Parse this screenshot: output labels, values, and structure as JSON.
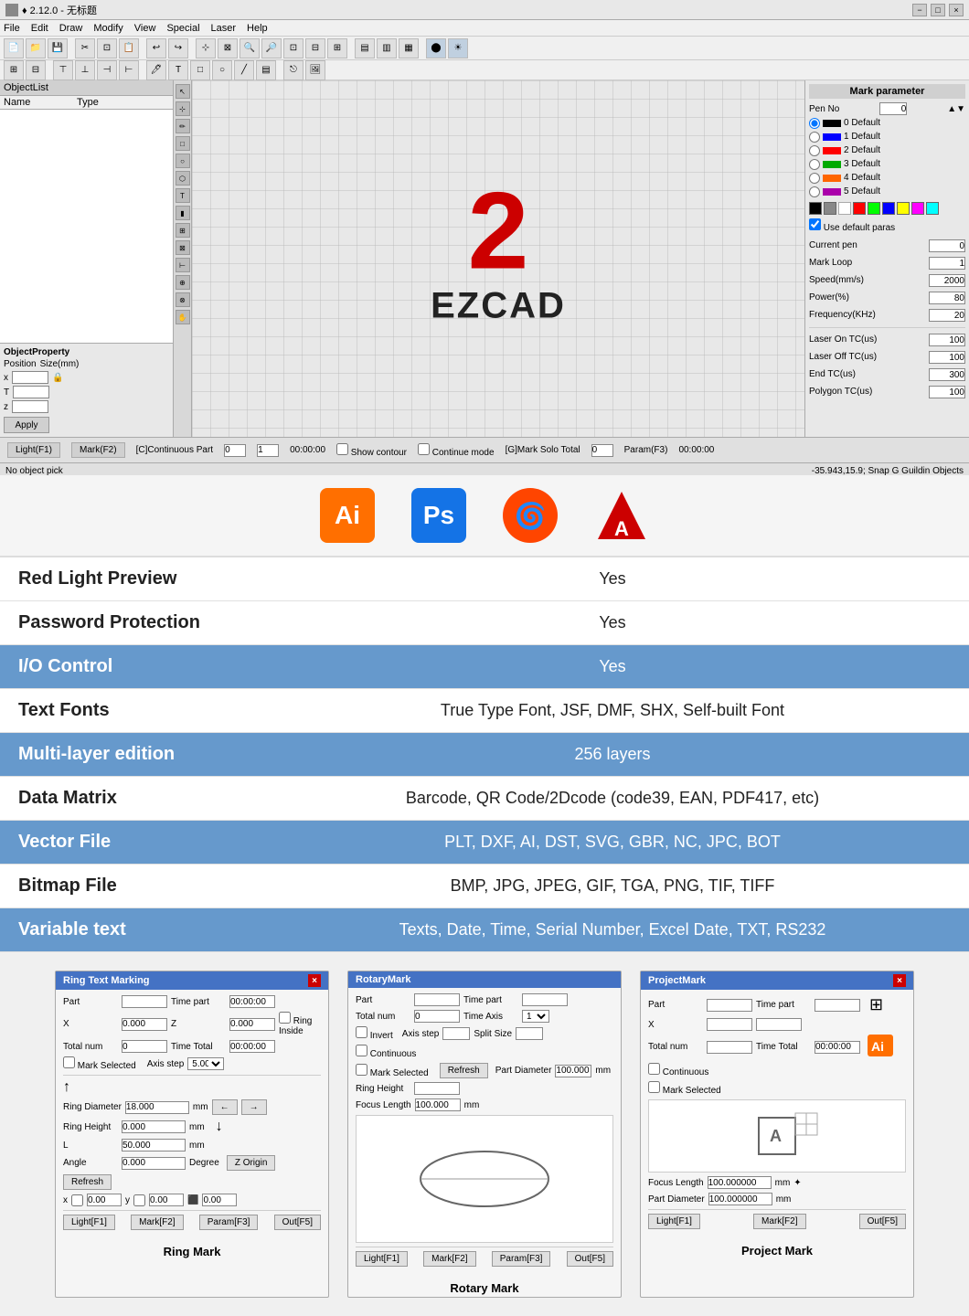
{
  "window": {
    "title": "2.12.0 - 无标题",
    "titlebar": "♦ 2.12.0 - 无标题",
    "controls": [
      "−",
      "□",
      "×"
    ]
  },
  "menubar": {
    "items": [
      "File",
      "Edit",
      "Draw",
      "Modify",
      "View",
      "Special",
      "Laser",
      "Help"
    ]
  },
  "canvas": {
    "number": "2",
    "text": "EZCAD"
  },
  "right_panel": {
    "title": "Mark parameter",
    "pen_no_label": "Pen No",
    "pens": [
      {
        "label": "Default",
        "color": "#000000"
      },
      {
        "label": "1 Default",
        "color": "#0000ff"
      },
      {
        "label": "2 Default",
        "color": "#ff0000"
      },
      {
        "label": "3 Default",
        "color": "#00aa00"
      },
      {
        "label": "4 Default",
        "color": "#ff6600"
      },
      {
        "label": "5 Default",
        "color": "#aa00aa"
      }
    ],
    "params": [
      {
        "label": "Use default paras",
        "type": "checkbox"
      },
      {
        "label": "Current pen",
        "value": "0"
      },
      {
        "label": "Mark Loop",
        "value": "1"
      },
      {
        "label": "Speed(mm/s)",
        "value": "2000"
      },
      {
        "label": "Power(%)",
        "value": "80"
      },
      {
        "label": "Frequency(KHz)",
        "value": "20"
      },
      {
        "label": "Laser On TC(us)",
        "value": "100"
      },
      {
        "label": "Laser Off TC(us)",
        "value": "100"
      },
      {
        "label": "End TC(us)",
        "value": "300"
      },
      {
        "label": "Polygon TC(us)",
        "value": "100"
      }
    ]
  },
  "icons": [
    {
      "id": "ai",
      "label": "Ai",
      "class": "icon-ai"
    },
    {
      "id": "ps",
      "label": "Ps",
      "class": "icon-ps"
    },
    {
      "id": "sn",
      "label": "🌀",
      "class": "icon-sn"
    },
    {
      "id": "a",
      "label": "A",
      "class": "icon-a"
    }
  ],
  "features": [
    {
      "label": "Red Light Preview",
      "value": "Yes",
      "highlight": false
    },
    {
      "label": "Password Protection",
      "value": "Yes",
      "highlight": false
    },
    {
      "label": "I/O Control",
      "value": "Yes",
      "highlight": true
    },
    {
      "label": "Text Fonts",
      "value": "True Type Font, JSF, DMF, SHX, Self-built Font",
      "highlight": false
    },
    {
      "label": "Multi-layer edition",
      "value": "256 layers",
      "highlight": true
    },
    {
      "label": "Data Matrix",
      "value": "Barcode, QR Code/2Dcode (code39, EAN, PDF417, etc)",
      "highlight": false
    },
    {
      "label": "Vector File",
      "value": "PLT, DXF, AI, DST, SVG, GBR, NC, JPC, BOT",
      "highlight": true
    },
    {
      "label": "Bitmap File",
      "value": "BMP, JPG, JPEG, GIF, TGA, PNG, TIF, TIFF",
      "highlight": false
    },
    {
      "label": "Variable text",
      "value": "Texts, Date, Time, Serial Number, Excel Date, TXT, RS232",
      "highlight": true
    }
  ],
  "dialogs": [
    {
      "id": "ring-mark",
      "title": "Ring Text Marking",
      "has_close": true,
      "caption": "Ring Mark",
      "fields": [
        {
          "label": "Part",
          "value": ""
        },
        {
          "label": "Time part",
          "value": ""
        },
        {
          "label": "X",
          "value": "0.000"
        },
        {
          "label": "Z",
          "value": "0.000"
        },
        {
          "label": "Ring Inside",
          "type": "checkbox"
        },
        {
          "label": "Total num",
          "value": "0"
        },
        {
          "label": "Time Total",
          "value": "00:00:00"
        },
        {
          "label": "Mark Selected",
          "type": "checkbox"
        },
        {
          "label": "Axis step",
          "value": ""
        },
        {
          "label": "Ring Diameter",
          "value": "18.000",
          "unit": "mm"
        },
        {
          "label": "Ring Height",
          "value": "0.000",
          "unit": "mm"
        },
        {
          "label": "L",
          "value": "50.000",
          "unit": "mm"
        },
        {
          "label": "Angle",
          "value": "0.000",
          "unit": "Degree"
        },
        {
          "label": "Z Origin",
          "value": ""
        }
      ],
      "buttons": [
        "Light[F1]",
        "Mark[F2]",
        "Param[F3]",
        "Out[F5]"
      ]
    },
    {
      "id": "rotary-mark",
      "title": "RotaryMark",
      "has_close": false,
      "caption": "Rotary Mark",
      "fields": [
        {
          "label": "Part",
          "value": ""
        },
        {
          "label": "Time part",
          "value": ""
        },
        {
          "label": "Total num",
          "value": "0"
        },
        {
          "label": "Time Axis",
          "value": ""
        },
        {
          "label": "Invert",
          "type": "checkbox"
        },
        {
          "label": "Axis step",
          "value": ""
        },
        {
          "label": "Split Size",
          "value": ""
        },
        {
          "label": "Continuous",
          "type": "checkbox"
        },
        {
          "label": "Mark Selected",
          "type": "checkbox"
        },
        {
          "label": "Refresh",
          "value": ""
        },
        {
          "label": "Part Diameter",
          "value": "100.000",
          "unit": "mm"
        },
        {
          "label": "Ring Height",
          "value": ""
        },
        {
          "label": "Focus Length",
          "value": "100.000",
          "unit": "mm"
        }
      ],
      "buttons": [
        "Light[F1]",
        "Mark[F2]",
        "Param[F3]",
        "Out[F5]"
      ]
    },
    {
      "id": "project-mark",
      "title": "ProjectMark",
      "has_close": true,
      "caption": "Project Mark",
      "fields": [
        {
          "label": "Part",
          "value": ""
        },
        {
          "label": "Time part",
          "value": ""
        },
        {
          "label": "X",
          "value": ""
        },
        {
          "label": "Total num",
          "value": ""
        },
        {
          "label": "Time Total",
          "value": "00:00:00"
        },
        {
          "label": "Continuous",
          "type": "checkbox"
        },
        {
          "label": "Mark Selected",
          "type": "checkbox"
        },
        {
          "label": "Focus Length",
          "value": "100.000000",
          "unit": "mm"
        },
        {
          "label": "Part Diameter",
          "value": "100.000000",
          "unit": "mm"
        }
      ],
      "buttons": [
        "Light[F1]",
        "Mark[F2]",
        "Out[F5]"
      ]
    }
  ],
  "status": {
    "left": "No object pick",
    "right": "-35.943,15.9; Snap G Guildin Objects"
  },
  "canvas_toolbar": {
    "continuous_label": "[C]Continuous Part",
    "g_mark_label": "[G]Mark Solo Total",
    "param_label": "Param(F3)",
    "show_contour_label": "Show contour",
    "continue_mode_label": "Continue mode",
    "time_left": "00:00:00",
    "time_right": "00:00:00",
    "p_value": "0",
    "light_btn": "Light(F1)",
    "mark_btn": "Mark(F2)"
  }
}
